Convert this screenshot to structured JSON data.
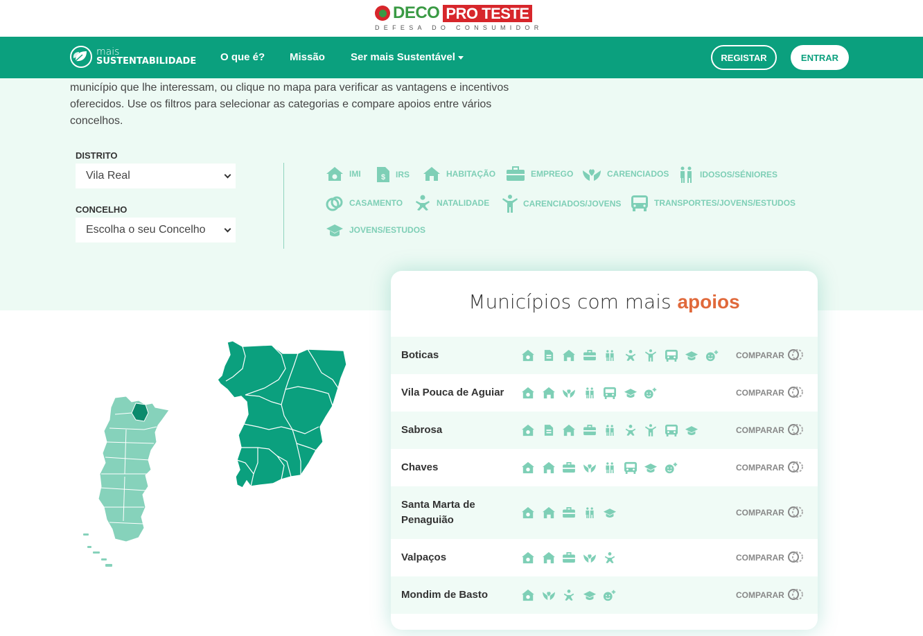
{
  "brand": {
    "name": "DECO",
    "name2": "PRO TESTE",
    "tagline": "DEFESA DO CONSUMIDOR"
  },
  "nav": {
    "logo_small": "mais",
    "logo_big": "SUSTENTABILIDADE",
    "items": [
      "O que é?",
      "Missão",
      "Ser mais Sustentável"
    ],
    "register": "REGISTAR",
    "login": "ENTRAR"
  },
  "intro": {
    "line1": "município que lhe interessam, ou clique no mapa para verificar as vantagens e incentivos",
    "line2": "oferecidos. Use os filtros para selecionar as categorias e compare apoios entre vários",
    "line3": "concelhos."
  },
  "filters": {
    "district_label": "DISTRITO",
    "district_value": "Vila Real",
    "county_label": "CONCELHO",
    "county_value": "Escolha o seu Concelho"
  },
  "categories": [
    {
      "label": "IMI",
      "icon": "house-euro-icon"
    },
    {
      "label": "IRS",
      "icon": "document-dollar-icon"
    },
    {
      "label": "HABITAÇÃO",
      "icon": "house-icon"
    },
    {
      "label": "EMPREGO",
      "icon": "briefcase-icon"
    },
    {
      "label": "CARENCIADOS",
      "icon": "hands-heart-icon"
    },
    {
      "label": "IDOSOS/SÉNIORES",
      "icon": "elderly-couple-icon"
    },
    {
      "label": "CASAMENTO",
      "icon": "rings-icon"
    },
    {
      "label": "NATALIDADE",
      "icon": "baby-icon"
    },
    {
      "label": "CARENCIADOS/JOVENS",
      "icon": "child-icon"
    },
    {
      "label": "TRANSPORTES/JOVENS/ESTUDOS",
      "icon": "bus-icon"
    },
    {
      "label": "JOVENS/ESTUDOS",
      "icon": "graduation-cap-icon"
    }
  ],
  "ranking": {
    "title": "Municípios com mais",
    "highlight": "apoios",
    "compare_label": "COMPARAR",
    "rows": [
      {
        "name": "Boticas",
        "icons": [
          "house-euro",
          "document",
          "house",
          "briefcase",
          "elderly",
          "baby",
          "child",
          "bus",
          "cap",
          "face-plus"
        ]
      },
      {
        "name": "Vila Pouca de Aguiar",
        "icons": [
          "house-euro",
          "house",
          "hands",
          "elderly",
          "bus",
          "cap",
          "face-plus"
        ]
      },
      {
        "name": "Sabrosa",
        "icons": [
          "house-euro",
          "document",
          "house",
          "briefcase",
          "elderly",
          "baby",
          "child",
          "bus",
          "cap"
        ]
      },
      {
        "name": "Chaves",
        "icons": [
          "house-euro",
          "house",
          "briefcase",
          "hands",
          "elderly",
          "bus",
          "cap",
          "face-plus"
        ]
      },
      {
        "name": "Santa Marta de Penaguião",
        "icons": [
          "house-euro",
          "house",
          "briefcase",
          "elderly",
          "cap"
        ]
      },
      {
        "name": "Valpaços",
        "icons": [
          "house-euro",
          "house",
          "briefcase",
          "hands",
          "baby"
        ]
      },
      {
        "name": "Mondim de Basto",
        "icons": [
          "house-euro",
          "hands",
          "baby",
          "cap",
          "face-plus"
        ]
      }
    ]
  },
  "colors": {
    "primary": "#0ba07e",
    "accent": "#e0693b",
    "icon": "#7ecfb6",
    "map_light": "#86d2bb"
  }
}
